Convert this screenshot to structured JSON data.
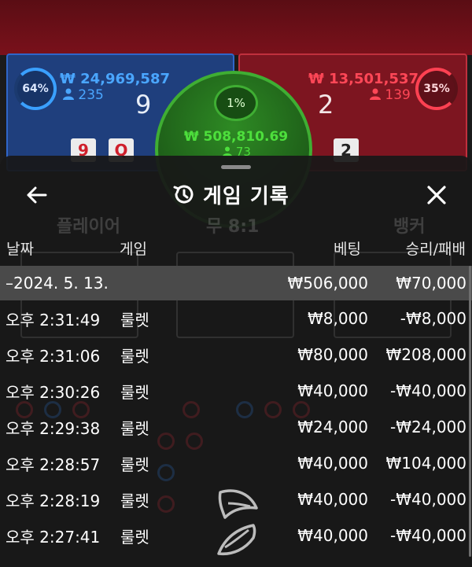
{
  "background": {
    "player": {
      "percent": "64%",
      "amount": "₩ 24,969,587",
      "count": "235",
      "score": "9"
    },
    "banker": {
      "percent": "35%",
      "amount": "₩ 13,501,537",
      "count": "139",
      "score": "2"
    },
    "tie": {
      "percent": "1%",
      "amount": "₩ 508,810.69",
      "count": "73"
    },
    "cards": {
      "player_1": "9",
      "player_2": "Q",
      "banker_1": "2"
    },
    "labels": {
      "player": "플레이어",
      "tie": "무 8:1",
      "banker": "뱅커"
    }
  },
  "sheet": {
    "title": "게임 기록",
    "columns": {
      "date": "날짜",
      "game": "게임",
      "bet": "베팅",
      "result": "승리/패배"
    },
    "date_group": {
      "label": "–2024. 5. 13.",
      "bet": "₩506,000",
      "result": "₩70,000"
    },
    "rows": [
      {
        "time": "오후 2:31:49",
        "game": "룰렛",
        "bet": "₩8,000",
        "result": "-₩8,000"
      },
      {
        "time": "오후 2:31:06",
        "game": "룰렛",
        "bet": "₩80,000",
        "result": "₩208,000"
      },
      {
        "time": "오후 2:30:26",
        "game": "룰렛",
        "bet": "₩40,000",
        "result": "-₩40,000"
      },
      {
        "time": "오후 2:29:38",
        "game": "룰렛",
        "bet": "₩24,000",
        "result": "-₩24,000"
      },
      {
        "time": "오후 2:28:57",
        "game": "룰렛",
        "bet": "₩40,000",
        "result": "₩104,000"
      },
      {
        "time": "오후 2:28:19",
        "game": "룰렛",
        "bet": "₩40,000",
        "result": "-₩40,000"
      },
      {
        "time": "오후 2:27:41",
        "game": "룰렛",
        "bet": "₩40,000",
        "result": "-₩40,000"
      }
    ]
  },
  "colors": {
    "player_blue": "#2f66c9",
    "banker_red": "#c0303d",
    "tie_green": "#3fae33",
    "sheet_bg": "#181818",
    "date_row_bg": "#4a4a4a"
  },
  "icons": {
    "back": "arrow-left-icon",
    "history": "history-clock-icon",
    "close": "close-icon",
    "person": "person-icon",
    "logo": "leaf-logo-icon"
  }
}
